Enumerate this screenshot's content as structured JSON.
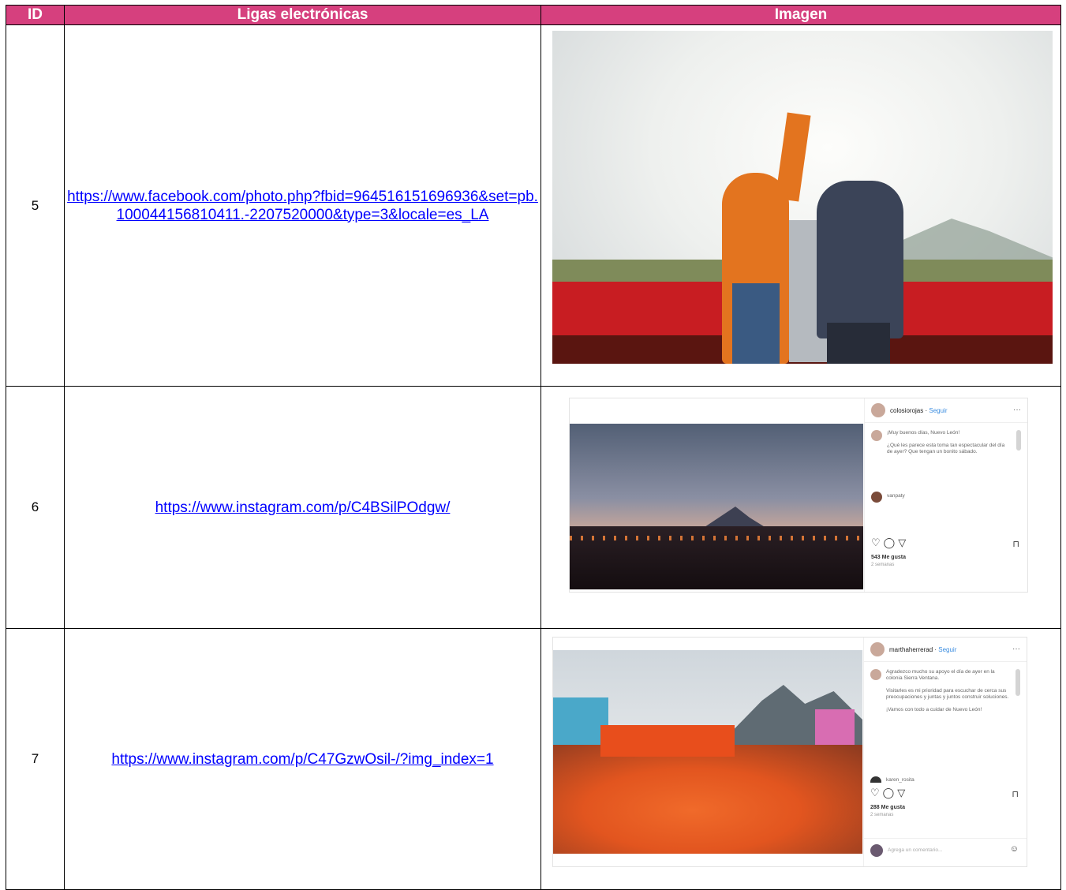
{
  "table": {
    "headers": {
      "id": "ID",
      "links": "Ligas electrónicas",
      "image": "Imagen"
    },
    "rows": [
      {
        "id": "5",
        "link": "https://www.facebook.com/photo.php?fbid=964516151696936&set=pb.100044156810411.-2207520000&type=3&locale=es_LA"
      },
      {
        "id": "6",
        "link": "https://www.instagram.com/p/C4BSilPOdgw/",
        "post": {
          "username": "colosiorojas",
          "follow": "Seguir",
          "caption_line1": "¡Muy buenos días, Nuevo León!",
          "caption_line2": "¿Qué les parece esta toma tan espectacular del día de ayer? Que tengan un bonito sábado.",
          "commenter": "vanpaty",
          "likes": "543 Me gusta",
          "ago": "2 semanas"
        }
      },
      {
        "id": "7",
        "link": "https://www.instagram.com/p/C47GzwOsil-/?img_index=1",
        "post": {
          "username": "marthaherrerad",
          "follow": "Seguir",
          "caption_line1": "Agradezco mucho su apoyo el día de ayer en la colonia Sierra Ventana.",
          "caption_line2": "Visitarles es mi prioridad para escuchar de cerca sus preocupaciones y juntas y juntos construir soluciones.",
          "caption_line3": "¡Vamos con todo a cuidar de Nuevo León!",
          "commenter": "karen_rosita",
          "likes": "288 Me gusta",
          "ago": "2 semanas",
          "comment_placeholder": "Agrega un comentario..."
        }
      }
    ]
  }
}
